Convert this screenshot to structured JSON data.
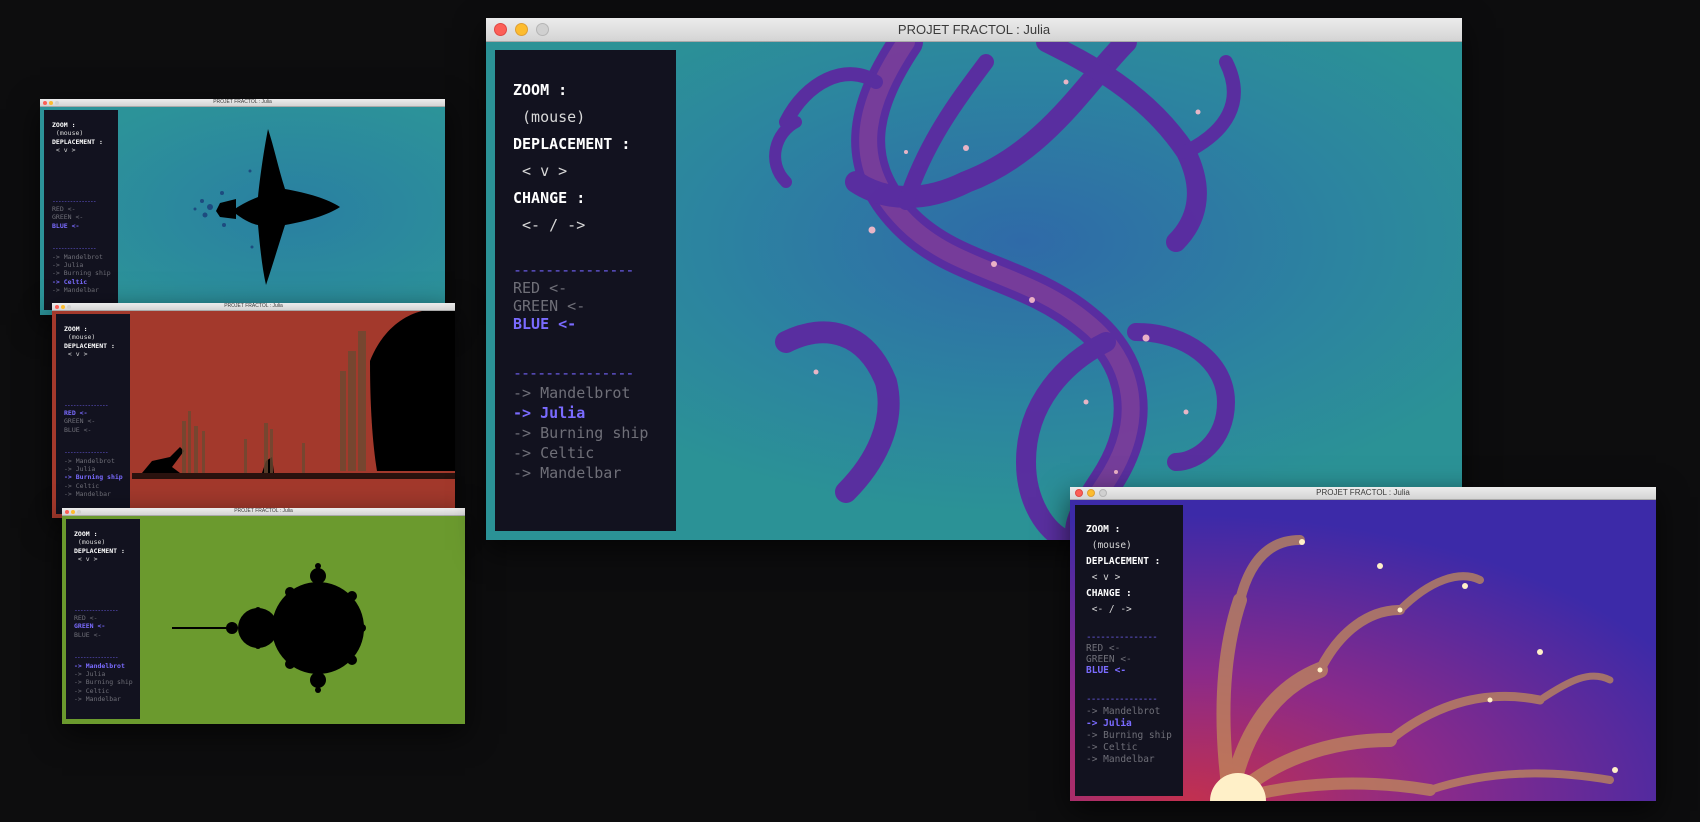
{
  "windows": {
    "main": {
      "title": "PROJET FRACTOL : Julia",
      "zoom_label": "ZOOM :",
      "zoom_hint": " (mouse)",
      "move_label": "DEPLACEMENT :",
      "move_hint": " < v >",
      "change_label": "CHANGE :",
      "change_hint": " <- / ->",
      "separator": "---------------",
      "colors": [
        "RED <-",
        "GREEN <-",
        "BLUE <-"
      ],
      "fractals": [
        "-> Mandelbrot",
        "-> Julia",
        "-> Burning ship",
        "-> Celtic",
        "-> Mandelbar"
      ]
    },
    "bottom_right": {
      "title": "PROJET FRACTOL : Julia",
      "zoom_label": "ZOOM :",
      "zoom_hint": " (mouse)",
      "move_label": "DEPLACEMENT :",
      "move_hint": " < v >",
      "change_label": "CHANGE :",
      "change_hint": " <- / ->",
      "separator": "---------------",
      "colors": [
        "RED <-",
        "GREEN <-",
        "BLUE <-"
      ],
      "fractals": [
        "-> Mandelbrot",
        "-> Julia",
        "-> Burning ship",
        "-> Celtic",
        "-> Mandelbar"
      ]
    },
    "small_celtic": {
      "title": "PROJET FRACTOL : Julia",
      "zoom_label": "ZOOM :",
      "zoom_hint": " (mouse)",
      "move_label": "DEPLACEMENT :",
      "move_hint": " < v >",
      "separator": "---------------",
      "colors": [
        "RED <-",
        "GREEN <-",
        "BLUE <-"
      ],
      "fractals": [
        "-> Mandelbrot",
        "-> Julia",
        "-> Burning ship",
        "-> Celtic",
        "-> Mandelbar"
      ]
    },
    "small_burning": {
      "title": "PROJET FRACTOL : Julia",
      "zoom_label": "ZOOM :",
      "zoom_hint": " (mouse)",
      "move_label": "DEPLACEMENT :",
      "move_hint": " < v >",
      "separator": "---------------",
      "colors": [
        "RED <-",
        "GREEN <-",
        "BLUE <-"
      ],
      "fractals": [
        "-> Mandelbrot",
        "-> Julia",
        "-> Burning ship",
        "-> Celtic",
        "-> Mandelbar"
      ]
    },
    "small_mandelbrot": {
      "title": "PROJET FRACTOL : Julia",
      "zoom_label": "ZOOM :",
      "zoom_hint": " (mouse)",
      "move_label": "DEPLACEMENT :",
      "move_hint": " < v >",
      "separator": "---------------",
      "colors": [
        "RED <-",
        "GREEN <-",
        "BLUE <-"
      ],
      "fractals": [
        "-> Mandelbrot",
        "-> Julia",
        "-> Burning ship",
        "-> Celtic",
        "-> Mandelbar"
      ]
    }
  },
  "colors": {
    "panel_bg": "#12121f",
    "active_item": "#7a6bff",
    "inactive_item": "#6f6f78",
    "separator": "#6b5ce7"
  },
  "icons": [
    "close-icon",
    "minimize-icon",
    "zoom-icon"
  ]
}
